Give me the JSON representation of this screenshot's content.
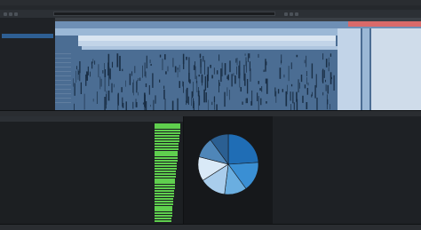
{
  "titlebar": {
    "title": ""
  },
  "menubar": {
    "items": []
  },
  "toolbar": {
    "path_text": "",
    "icons": [
      "back-icon",
      "forward-icon",
      "refresh-icon",
      "settings-icon",
      "filter-icon",
      "search-icon"
    ]
  },
  "left_panel": {
    "header": "",
    "selected_item": ""
  },
  "bottom_tabs": [],
  "tree": {
    "columns": [],
    "rows": [
      {
        "level": 0,
        "bar": 0.98
      },
      {
        "level": 1,
        "bar": 0.97
      },
      {
        "level": 1,
        "bar": 0.96
      },
      {
        "level": 2,
        "bar": 0.95
      },
      {
        "level": 2,
        "bar": 0.94
      },
      {
        "level": 2,
        "bar": 0.93
      },
      {
        "level": 3,
        "bar": 0.92
      },
      {
        "level": 3,
        "bar": 0.91
      },
      {
        "level": 3,
        "bar": 0.9
      },
      {
        "level": 3,
        "bar": 0.89
      },
      {
        "level": 4,
        "bar": 0.88
      },
      {
        "level": 4,
        "bar": 0.87
      },
      {
        "level": 4,
        "bar": 0.86
      },
      {
        "level": 4,
        "bar": 0.85
      },
      {
        "level": 4,
        "bar": 0.84
      },
      {
        "level": 3,
        "bar": 0.83
      },
      {
        "level": 3,
        "bar": 0.82
      },
      {
        "level": 3,
        "bar": 0.81
      },
      {
        "level": 3,
        "bar": 0.8
      },
      {
        "level": 3,
        "bar": 0.79
      },
      {
        "level": 3,
        "bar": 0.78
      },
      {
        "level": 3,
        "bar": 0.77
      },
      {
        "level": 3,
        "bar": 0.76
      },
      {
        "level": 3,
        "bar": 0.75
      },
      {
        "level": 3,
        "bar": 0.74
      },
      {
        "level": 3,
        "bar": 0.73
      },
      {
        "level": 3,
        "bar": 0.72
      },
      {
        "level": 3,
        "bar": 0.71
      },
      {
        "level": 3,
        "bar": 0.7
      },
      {
        "level": 3,
        "bar": 0.69
      },
      {
        "level": 3,
        "bar": 0.68
      },
      {
        "level": 3,
        "bar": 0.67
      },
      {
        "level": 2,
        "bar": 0.66
      },
      {
        "level": 2,
        "bar": 0.65
      },
      {
        "level": 2,
        "bar": 0.64
      },
      {
        "level": 1,
        "bar": 0.63
      }
    ]
  },
  "pie_panel": {
    "title": "",
    "colors": [
      "#1f6db5",
      "#3a8fd4",
      "#6aaee0",
      "#a9cdec",
      "#d9e9f7",
      "#4f86b8",
      "#2b5f92"
    ]
  },
  "chart_data": {
    "type": "pie",
    "title": "",
    "labels": [],
    "values": [
      0.24,
      0.16,
      0.12,
      0.14,
      0.13,
      0.11,
      0.1
    ]
  },
  "code": {
    "lines": []
  },
  "status": {
    "items": []
  },
  "colors": {
    "timeline_bg": "#4b6d93",
    "bar_highlight": "#5fcf4e",
    "selection": "#2e5f93"
  }
}
